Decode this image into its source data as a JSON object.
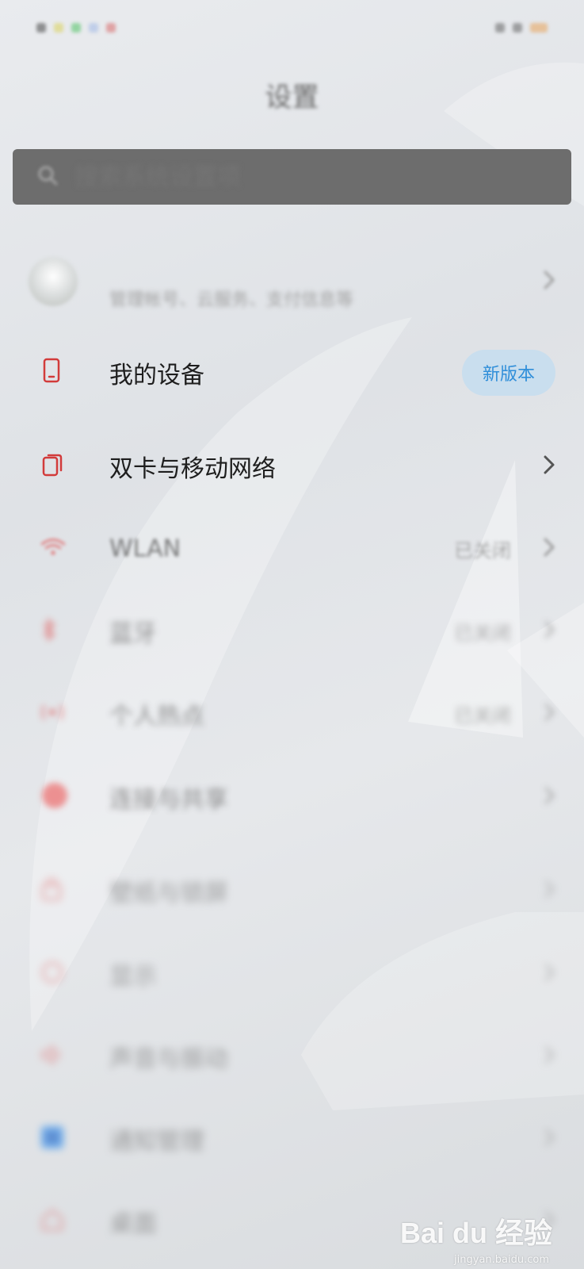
{
  "status_bar": {
    "time": "",
    "battery": ""
  },
  "page": {
    "title": "设置"
  },
  "search": {
    "placeholder": "搜索系统设置项"
  },
  "account": {
    "name": "",
    "subtitle": "管理帐号、云服务、支付信息等"
  },
  "items": [
    {
      "label": "我的设备",
      "badge": "新版本",
      "icon": "phone-outline-icon",
      "icon_color": "#d23b3b"
    },
    {
      "label": "双卡与移动网络",
      "icon": "dual-sim-icon",
      "icon_color": "#d23b3b"
    },
    {
      "label": "WLAN",
      "value": "已关闭",
      "icon": "wifi-icon",
      "icon_color": "#e05a5a"
    },
    {
      "label": "蓝牙",
      "value": "已关闭",
      "icon": "bluetooth-icon"
    },
    {
      "label": "个人热点",
      "value": "已关闭",
      "icon": "hotspot-icon"
    },
    {
      "label": "连接与共享",
      "icon": "connection-sharing-icon"
    },
    {
      "label": "壁纸与锁屏",
      "icon": "lock-screen-icon"
    },
    {
      "label": "显示",
      "icon": "display-icon"
    },
    {
      "label": "声音与振动",
      "icon": "sound-icon"
    },
    {
      "label": "通知管理",
      "icon": "notification-icon",
      "icon_color": "#2f8ff0"
    },
    {
      "label": "桌面",
      "icon": "desktop-icon"
    }
  ],
  "watermark": {
    "text": "Bai du 经验",
    "sub": "jingyan.baidu.com"
  }
}
